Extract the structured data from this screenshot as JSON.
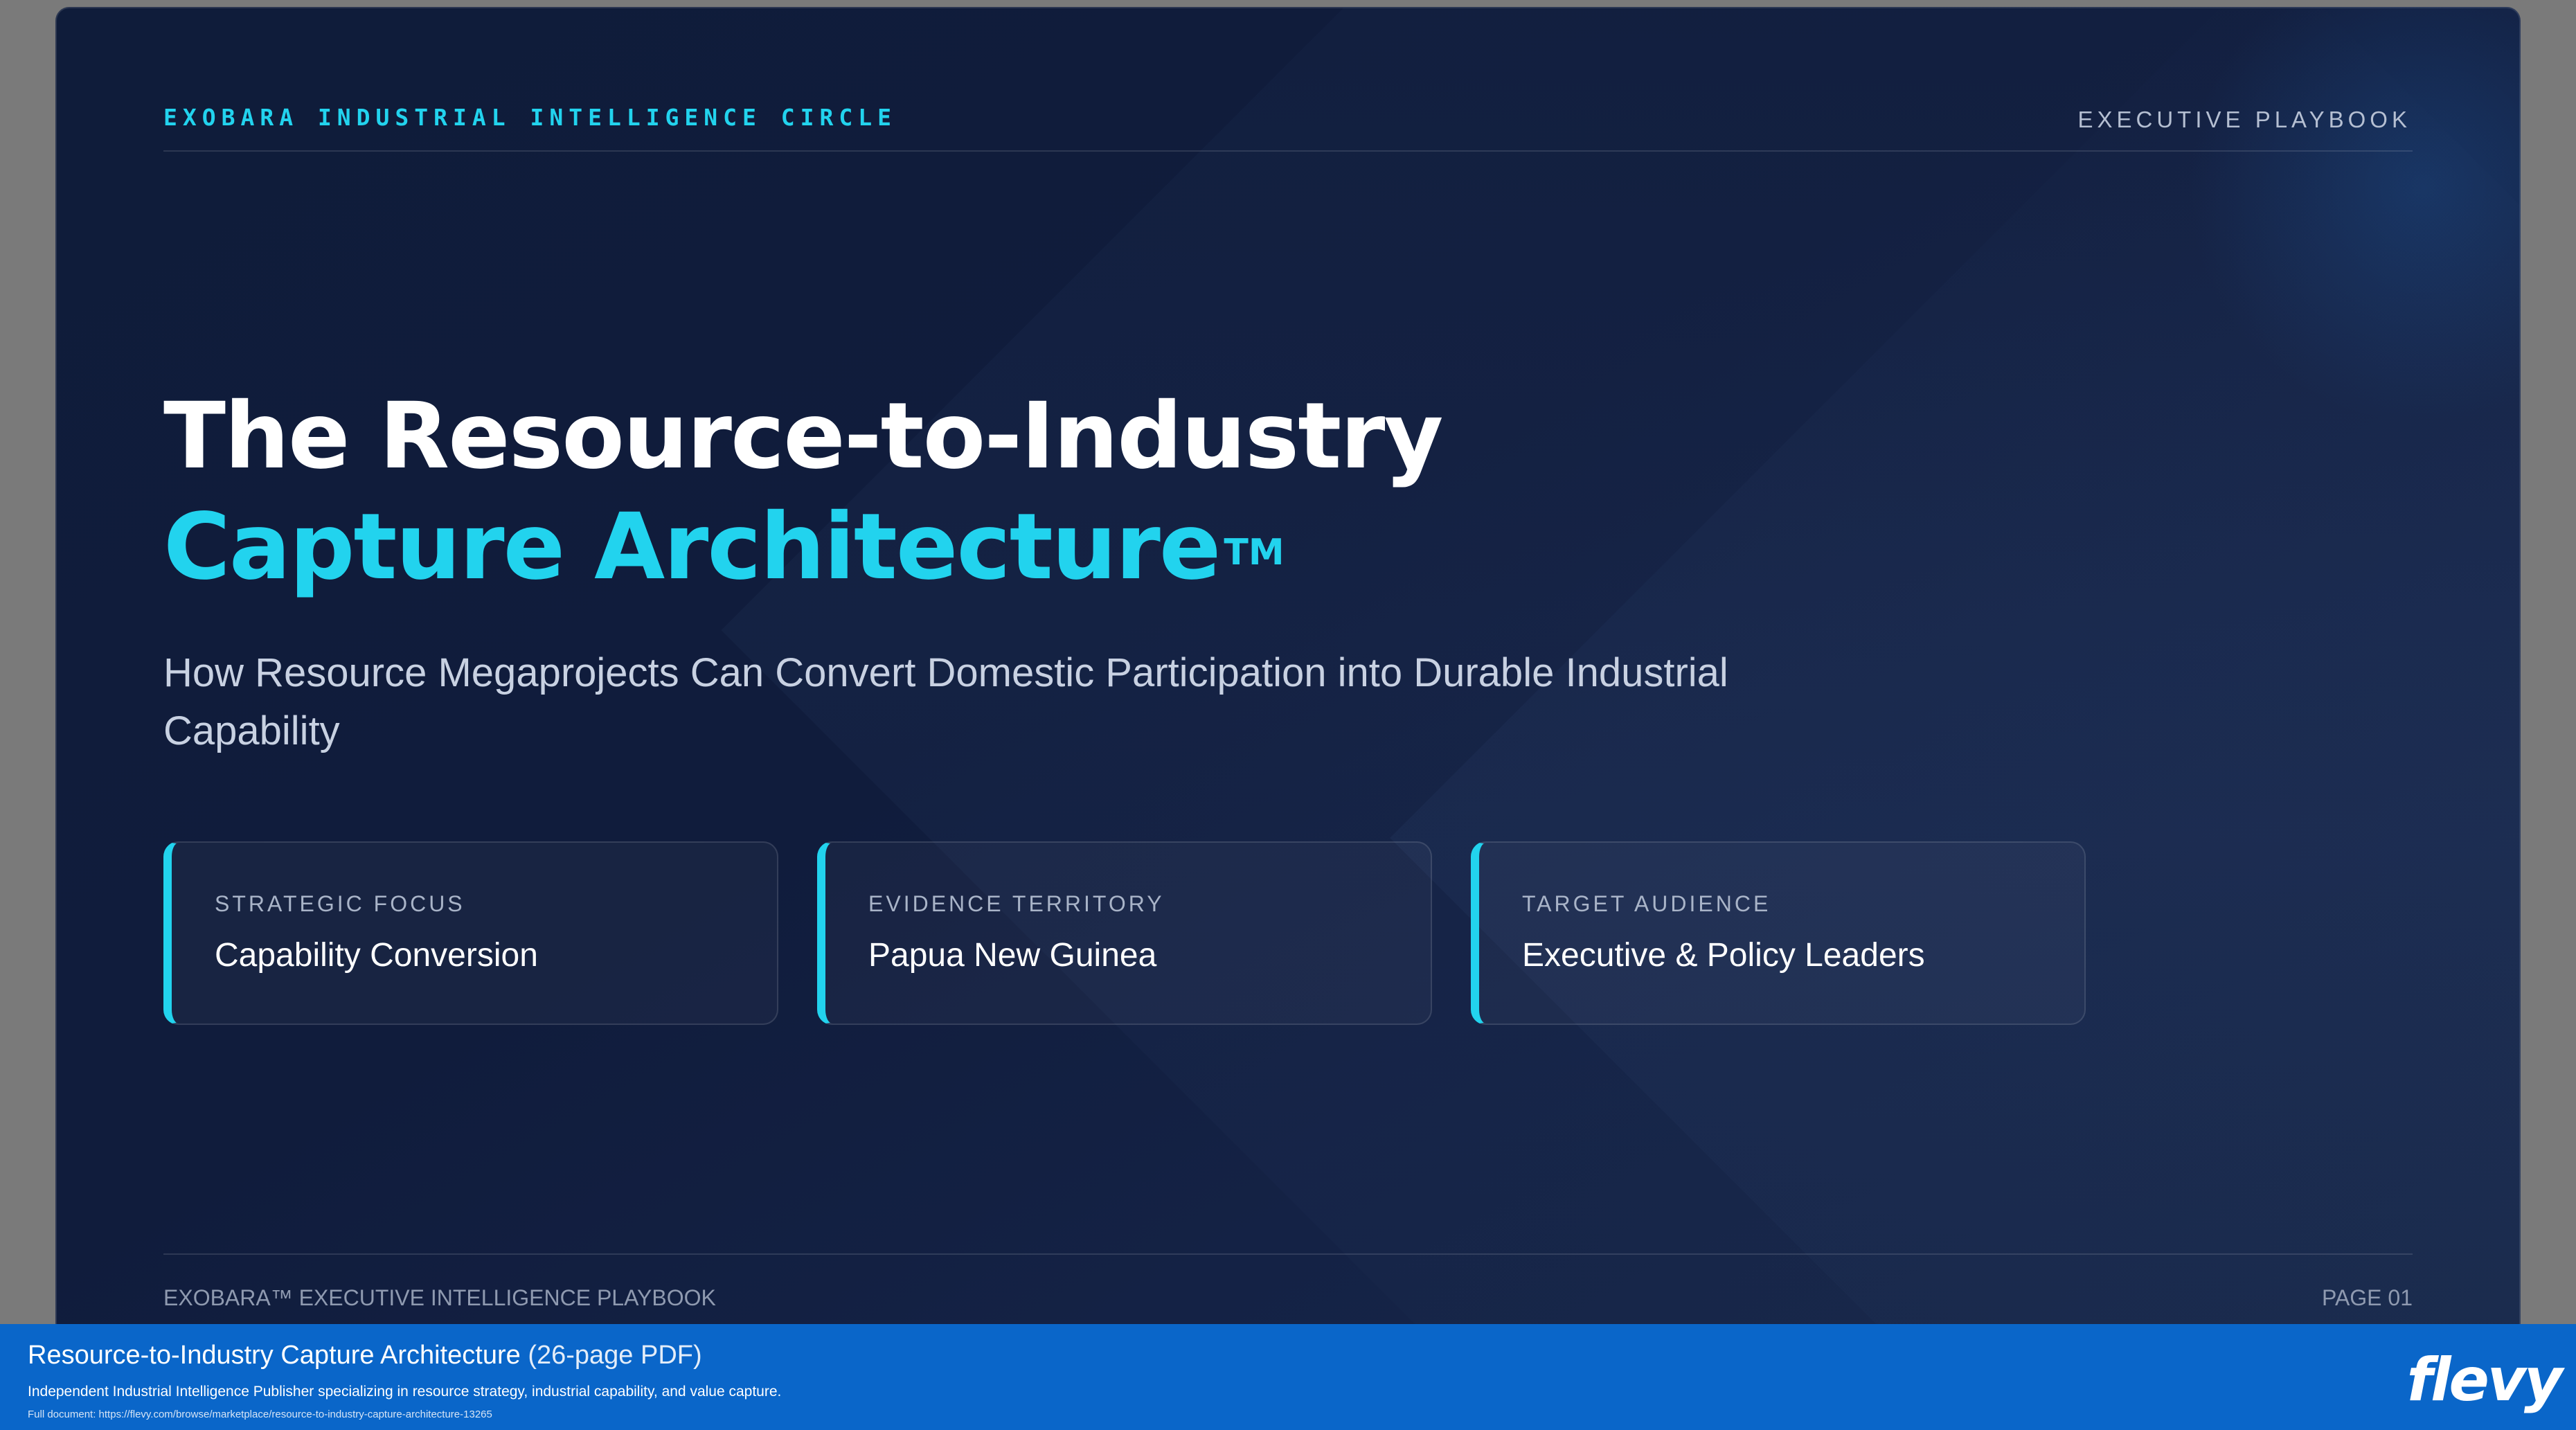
{
  "slide": {
    "brand": "EXOBARA INDUSTRIAL INTELLIGENCE CIRCLE",
    "playbook_label": "EXECUTIVE PLAYBOOK",
    "title_line1": "The Resource-to-Industry",
    "title_line2": "Capture Architecture",
    "trademark": "TM",
    "subtitle": "How Resource Megaprojects Can Convert Domestic Participation into Durable Industrial Capability",
    "cards": [
      {
        "label": "STRATEGIC FOCUS",
        "value": "Capability Conversion"
      },
      {
        "label": "EVIDENCE TERRITORY",
        "value": "Papua New Guinea"
      },
      {
        "label": "TARGET AUDIENCE",
        "value": "Executive & Policy Leaders"
      }
    ],
    "footer_left": "EXOBARA™ EXECUTIVE INTELLIGENCE PLAYBOOK",
    "footer_right": "PAGE 01"
  },
  "banner": {
    "title": "Resource-to-Industry Capture Architecture",
    "pages": "(26-page PDF)",
    "description": "Independent Industrial Intelligence Publisher specializing in resource strategy, industrial capability, and value capture.",
    "url": "Full document: https://flevy.com/browse/marketplace/resource-to-industry-capture-architecture-13265",
    "logo": "flevy"
  },
  "colors": {
    "accent": "#22d3ee",
    "slide_background": "#101c3c",
    "banner_background": "#0a66c9"
  }
}
